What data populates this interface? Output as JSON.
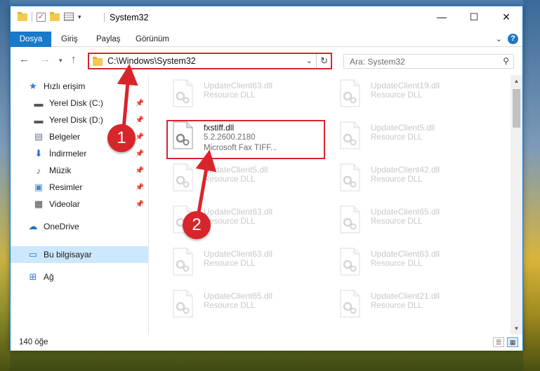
{
  "window": {
    "title": "System32",
    "controls": {
      "minimize": "—",
      "maximize": "☐",
      "close": "✕"
    }
  },
  "ribbon": {
    "tabs": [
      "Dosya",
      "Giriş",
      "Paylaş",
      "Görünüm"
    ],
    "help": "?"
  },
  "address": {
    "path": "C:\\Windows\\System32"
  },
  "search": {
    "placeholder": "Ara: System32"
  },
  "nav": {
    "quick_access": "Hızlı erişim",
    "items": [
      {
        "label": "Yerel Disk (C:)",
        "icon": "drive-icon",
        "pinned": true
      },
      {
        "label": "Yerel Disk (D:)",
        "icon": "drive-icon",
        "pinned": true
      },
      {
        "label": "Belgeler",
        "icon": "documents-icon",
        "pinned": true
      },
      {
        "label": "İndirmeler",
        "icon": "downloads-icon",
        "pinned": true
      },
      {
        "label": "Müzik",
        "icon": "music-icon",
        "pinned": true
      },
      {
        "label": "Resimler",
        "icon": "pictures-icon",
        "pinned": true
      },
      {
        "label": "Videolar",
        "icon": "videos-icon",
        "pinned": true
      }
    ],
    "onedrive": "OneDrive",
    "this_pc": "Bu bilgisayar",
    "network": "Ağ"
  },
  "files": {
    "left": [
      {
        "name": "UpdateClient63.dll",
        "desc": "Resource DLL"
      },
      {
        "name": "fxstiff.dll",
        "desc": "5.2.2600.2180",
        "desc2": "Microsoft  Fax TIFF...",
        "highlighted": true
      },
      {
        "name": "UpdateClient5.dll",
        "desc": "Resource DLL"
      },
      {
        "name": "UpdateClient63.dll",
        "desc": "Resource DLL"
      },
      {
        "name": "UpdateClient63.dll",
        "desc": "Resource DLL"
      },
      {
        "name": "UpdateClient65.dll",
        "desc": "Resource DLL"
      }
    ],
    "right": [
      {
        "name": "UpdateClient19.dll",
        "desc": "Resource DLL"
      },
      {
        "name": "UpdateClient5.dll",
        "desc": "Resource DLL"
      },
      {
        "name": "UpdateClient42.dll",
        "desc": "Resource DLL"
      },
      {
        "name": "UpdateClient65.dll",
        "desc": "Resource DLL"
      },
      {
        "name": "UpdateClient63.dll",
        "desc": "Resource DLL"
      },
      {
        "name": "UpdateClient21.dll",
        "desc": "Resource DLL"
      }
    ]
  },
  "status": {
    "count": "140 öğe"
  },
  "annotations": {
    "step1": "1",
    "step2": "2",
    "color": "#d7262b"
  }
}
